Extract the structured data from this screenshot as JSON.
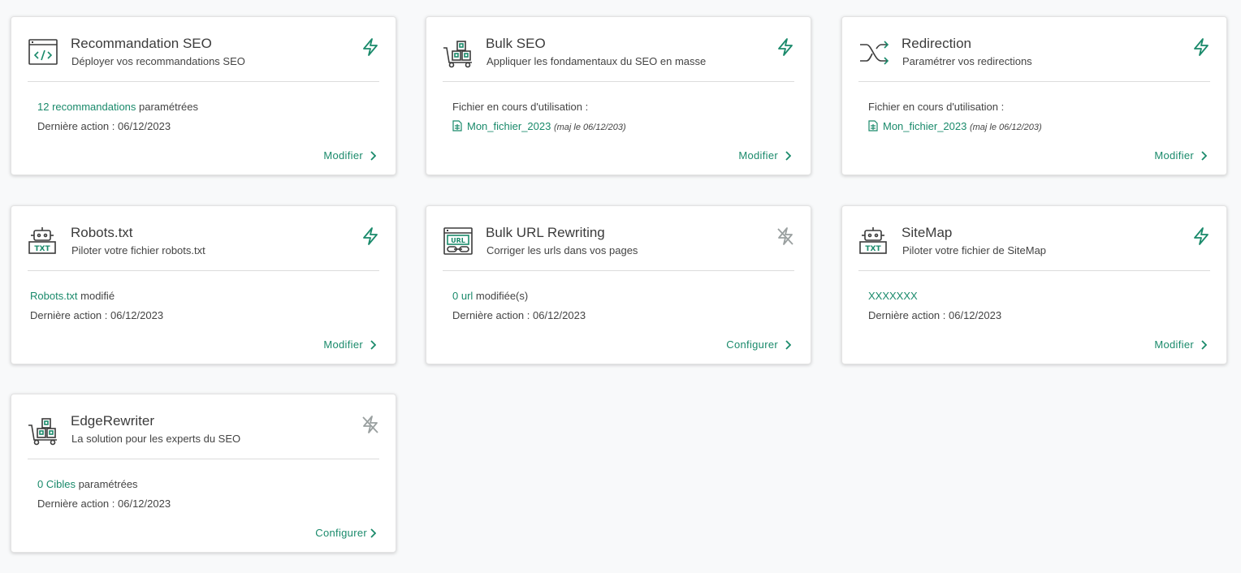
{
  "colors": {
    "accent": "#1a8a6b",
    "muted": "#9aa0a0",
    "text": "#3c3c3c"
  },
  "cards": [
    {
      "title": "Recommandation SEO",
      "subtitle": "Déployer vos recommandations SEO",
      "icon": "code-window-icon",
      "status": "active",
      "line1_link": "12 recommandations",
      "line1_text": " paramétrées",
      "line2": "Dernière action : 06/12/2023",
      "action": "Modifier"
    },
    {
      "title": "Bulk SEO",
      "subtitle": "Appliquer les fondamentaux du SEO en masse",
      "icon": "hand-truck-boxes-icon",
      "status": "active",
      "line1_text": "Fichier en cours d'utilisation :",
      "file_name": "Mon_fichier_2023",
      "file_note": "(maj le 06/12/203)",
      "action": "Modifier"
    },
    {
      "title": "Redirection",
      "subtitle": "Paramétrer vos redirections",
      "icon": "shuffle-arrows-icon",
      "status": "active",
      "line1_text": "Fichier en cours d'utilisation :",
      "file_name": "Mon_fichier_2023",
      "file_note": "(maj le 06/12/203)",
      "action": "Modifier"
    },
    {
      "title": "Robots.txt",
      "subtitle": "Piloter votre fichier robots.txt",
      "icon": "robot-txt-icon",
      "status": "active",
      "line1_link": "Robots.txt",
      "line1_text": " modifié",
      "line2": "Dernière action : 06/12/2023",
      "action": "Modifier"
    },
    {
      "title": "Bulk URL Rewriting",
      "subtitle": "Corriger les urls dans vos pages",
      "icon": "url-link-window-icon",
      "status": "inactive",
      "line1_link": "0 url",
      "line1_text": " modifiée(s)",
      "line2": "Dernière action : 06/12/2023",
      "action": "Configurer"
    },
    {
      "title": "SiteMap",
      "subtitle": "Piloter votre fichier de SiteMap",
      "icon": "robot-txt-icon",
      "status": "active",
      "line1_link": "XXXXXXX",
      "line1_text": "",
      "line2": "Dernière action : 06/12/2023",
      "action": "Modifier"
    },
    {
      "title": "EdgeRewriter",
      "subtitle": "La solution pour les experts du SEO",
      "icon": "hand-truck-boxes-icon",
      "status": "inactive",
      "line1_link": "0 Cibles",
      "line1_text": " paramétrées",
      "line2": "Dernière action : 06/12/2023",
      "action": "Configurer"
    }
  ]
}
